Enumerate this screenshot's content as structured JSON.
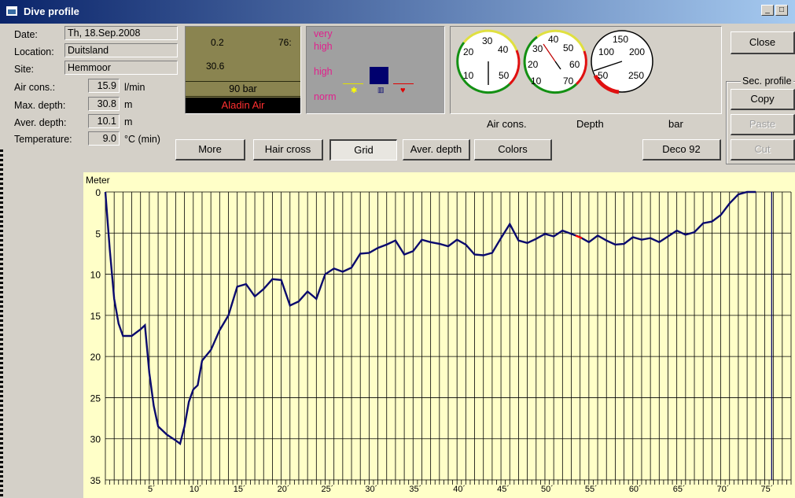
{
  "window": {
    "title": "Dive profile"
  },
  "info": {
    "date_label": "Date:",
    "date_value": "Th, 18.Sep.2008",
    "location_label": "Location:",
    "location_value": "Duitsland",
    "site_label": "Site:",
    "site_value": "Hemmoor",
    "air_label": "Air cons.:",
    "air_value": "15.9",
    "air_unit": "l/min",
    "maxdepth_label": "Max. depth:",
    "maxdepth_value": "30.8",
    "maxdepth_unit": "m",
    "avgdepth_label": "Aver. depth:",
    "avgdepth_value": "10.1",
    "avgdepth_unit": "m",
    "temp_label": "Temperature:",
    "temp_value": "9.0",
    "temp_unit": "°C  (min)"
  },
  "computer_panel": {
    "val_a": "0.2",
    "val_b": "76:",
    "val_c": "30.6",
    "pressure": "90 bar",
    "device": "Aladin Air"
  },
  "warn_panel": {
    "very": "very",
    "high1": "high",
    "high2": "high",
    "norm": "norm"
  },
  "gauges": {
    "air": {
      "label": "Air cons.",
      "ticks": [
        "30",
        "40",
        "20",
        "10",
        "50"
      ]
    },
    "depth": {
      "label": "Depth",
      "ticks": [
        "40",
        "50",
        "30",
        "20",
        "60",
        "10",
        "70"
      ]
    },
    "bar": {
      "label": "bar",
      "ticks": [
        "150",
        "100",
        "200",
        "50",
        "250"
      ]
    }
  },
  "buttons": {
    "more": "More",
    "hair": "Hair cross",
    "grid": "Grid",
    "avg": "Aver. depth",
    "colors": "Colors",
    "deco": "Deco 92",
    "close": "Close",
    "copy": "Copy",
    "paste": "Paste",
    "cut": "Cut"
  },
  "sec_profile": "Sec. profile",
  "colors": {
    "chart_bg": "#ffffc8",
    "line": "#0a0a6e",
    "warn_magenta": "#e0208c",
    "device_red": "#ff3030"
  },
  "chart_data": {
    "type": "line",
    "ylabel": "Meter",
    "y_ticks": [
      "0",
      "5",
      "10",
      "15",
      "20",
      "25",
      "30",
      "35"
    ],
    "x_ticks": [
      "5´",
      "10´",
      "15´",
      "20´",
      "25´",
      "30´",
      "35´",
      "40´",
      "45´",
      "50´",
      "55´",
      "60´",
      "65´",
      "70´",
      "75´"
    ],
    "xlim": [
      0,
      78
    ],
    "ylim": [
      0,
      35
    ],
    "y_inverted": true,
    "grid": true,
    "x": [
      0,
      0.5,
      1,
      1.5,
      2,
      3,
      4,
      4.5,
      5,
      5.5,
      6,
      7,
      8,
      8.5,
      9,
      9.5,
      10,
      10.5,
      11,
      12,
      13,
      14,
      15,
      16,
      17,
      18,
      19,
      20,
      21,
      22,
      23,
      24,
      25,
      26,
      27,
      28,
      29,
      30,
      31,
      32,
      33,
      34,
      35,
      36,
      37,
      38,
      39,
      40,
      41,
      42,
      43,
      44,
      45,
      46,
      47,
      48,
      49,
      50,
      51,
      52,
      53,
      54,
      55,
      56,
      57,
      58,
      59,
      60,
      61,
      62,
      63,
      64,
      65,
      66,
      67,
      68,
      69,
      70,
      71,
      72,
      73,
      74,
      75,
      75.8,
      76.2,
      78
    ],
    "y": [
      0,
      7,
      13,
      16,
      17.5,
      17.5,
      16.7,
      16.2,
      22,
      26,
      28.5,
      29.5,
      30.2,
      30.6,
      28.5,
      25.5,
      24,
      23.5,
      20.5,
      19.2,
      16.8,
      15,
      11.5,
      11.2,
      12.7,
      11.8,
      10.6,
      10.7,
      13.8,
      13.3,
      12.1,
      13,
      10,
      9.3,
      9.7,
      9.2,
      7.5,
      7.4,
      6.8,
      6.4,
      5.9,
      7.6,
      7.2,
      5.8,
      6.1,
      6.3,
      6.6,
      5.8,
      6.4,
      7.6,
      7.7,
      7.4,
      5.6,
      3.9,
      5.9,
      6.2,
      5.7,
      5.1,
      5.4,
      4.7,
      5.1,
      5.5,
      6.1,
      5.3,
      5.9,
      6.4,
      6.3,
      5.5,
      5.8,
      5.6,
      6.1,
      5.4,
      4.7,
      5.2,
      4.9,
      3.8,
      3.6,
      2.8,
      1.4,
      0.3,
      0,
      0
    ],
    "highlight_segment": {
      "x": [
        53.5,
        54.2
      ],
      "color": "#ff0000"
    }
  }
}
